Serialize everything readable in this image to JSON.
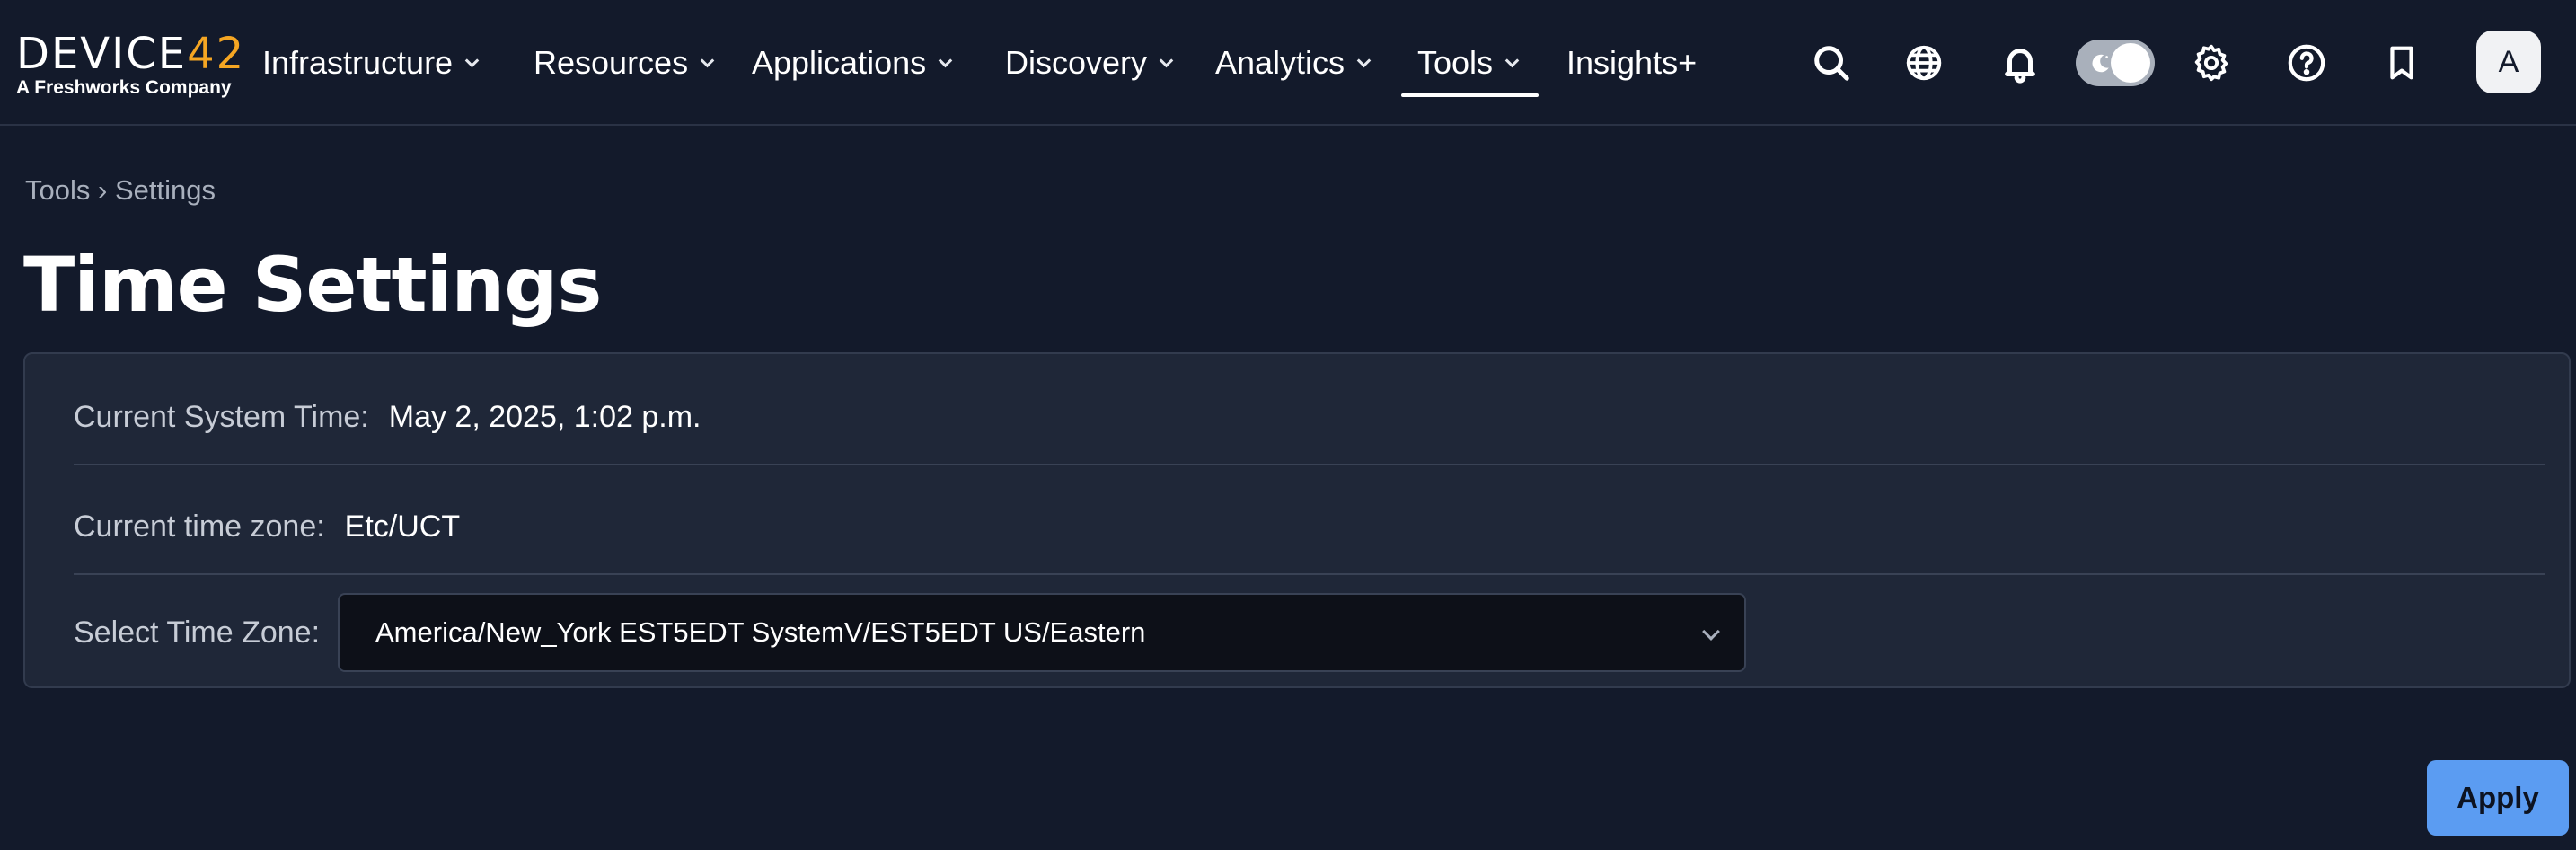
{
  "brand": {
    "logo_main": "DEVICE",
    "logo_accent": "42",
    "logo_sub": "A Freshworks Company"
  },
  "nav": {
    "items": [
      {
        "label": "Infrastructure",
        "has_dropdown": true
      },
      {
        "label": "Resources",
        "has_dropdown": true
      },
      {
        "label": "Applications",
        "has_dropdown": true
      },
      {
        "label": "Discovery",
        "has_dropdown": true
      },
      {
        "label": "Analytics",
        "has_dropdown": true
      },
      {
        "label": "Tools",
        "has_dropdown": true,
        "active": true
      },
      {
        "label": "Insights+",
        "has_dropdown": false
      }
    ],
    "icons": [
      "search-icon",
      "globe-icon",
      "bell-icon",
      "theme-toggle",
      "gear-icon",
      "help-icon",
      "bookmark-icon"
    ],
    "avatar_initial": "A"
  },
  "breadcrumb": {
    "parent": "Tools",
    "separator": "›",
    "current": "Settings"
  },
  "page": {
    "title": "Time Settings"
  },
  "time_settings": {
    "system_time_label": "Current System Time:",
    "system_time_value": "May 2, 2025, 1:02 p.m.",
    "current_tz_label": "Current time zone:",
    "current_tz_value": "Etc/UCT",
    "select_label": "Select Time Zone:",
    "select_value": "America/New_York EST5EDT SystemV/EST5EDT US/Eastern"
  },
  "actions": {
    "apply_label": "Apply"
  },
  "colors": {
    "background": "#131a2b",
    "card": "#1f2738",
    "accent": "#f5a623",
    "primary_button": "#5b9cf2"
  }
}
